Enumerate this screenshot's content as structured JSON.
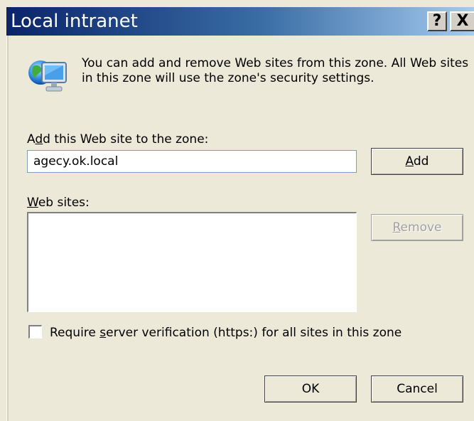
{
  "window": {
    "title": "Local intranet",
    "help_label": "?",
    "close_label": "X"
  },
  "intro": {
    "text": "You can add and remove Web sites from this zone. All Web sites in this zone will use the zone's security settings."
  },
  "add_site": {
    "label_first": "A",
    "label_accel": "d",
    "label_rest": "d this Web site to the zone:",
    "value": "agecy.ok.local",
    "button_accel": "A",
    "button_rest": "dd"
  },
  "web_sites": {
    "label_accel": "W",
    "label_rest": "eb sites:",
    "items": [],
    "remove_accel": "R",
    "remove_rest": "emove",
    "remove_enabled": false
  },
  "verification": {
    "label_pre": "Require ",
    "label_accel": "s",
    "label_post": "erver verification (https:) for all sites in this zone",
    "checked": false
  },
  "footer": {
    "ok_label": "OK",
    "cancel_label": "Cancel"
  },
  "colors": {
    "title_gradient_start": "#0a246a",
    "title_gradient_end": "#a6caf0",
    "dialog_bg": "#ece9d8"
  }
}
